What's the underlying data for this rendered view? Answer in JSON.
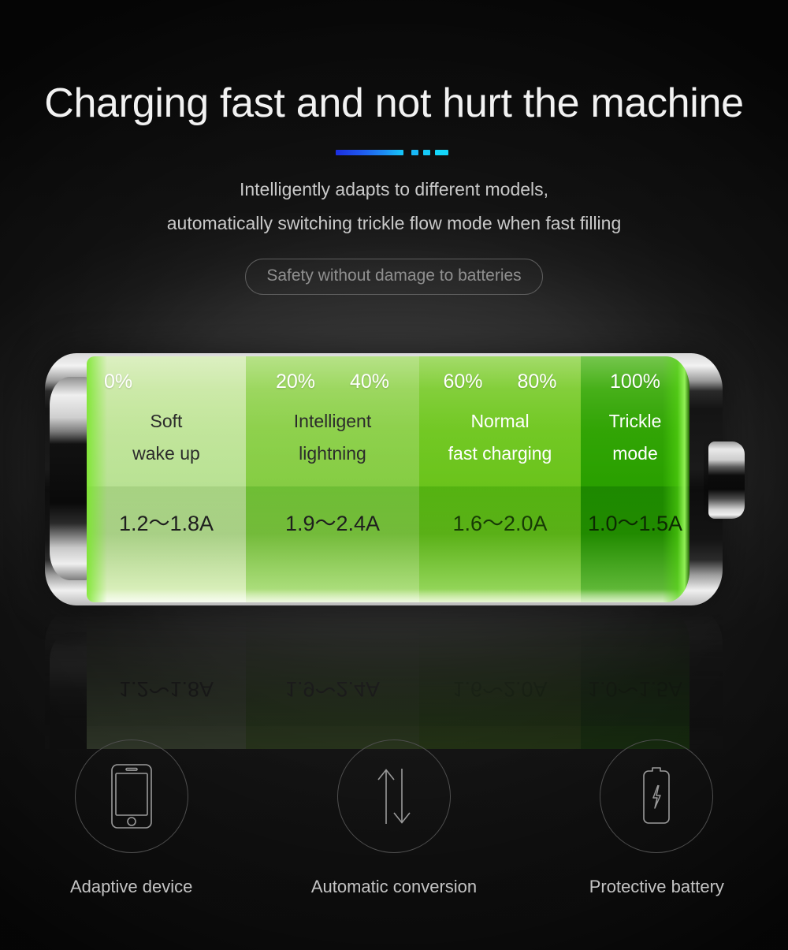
{
  "header": {
    "title": "Charging fast and not hurt the machine",
    "subtitle_line1": "Intelligently adapts to different models,",
    "subtitle_line2": "automatically switching trickle flow mode when fast filling",
    "pill_label": "Safety without damage to batteries"
  },
  "colors": {
    "background": "#171717",
    "title_text": "#f2f2f2",
    "subtitle_text": "#c9c9c9",
    "pill_border": "#5d5d5d",
    "divider_start": "#1b2ee0",
    "divider_end": "#14d6fa",
    "segment_1": "#c3e69b",
    "segment_2": "#8ed14b",
    "segment_3": "#72c822",
    "segment_4": "#2fa400"
  },
  "battery": {
    "segments": [
      {
        "percent_labels": [
          "0%"
        ],
        "mode_line1": "Soft",
        "mode_line2": "wake up",
        "current": "1.2～1.8A"
      },
      {
        "percent_labels": [
          "20%",
          "40%"
        ],
        "mode_line1": "Intelligent",
        "mode_line2": "lightning",
        "current": "1.9～2.4A"
      },
      {
        "percent_labels": [
          "60%",
          "80%"
        ],
        "mode_line1": "Normal",
        "mode_line2": "fast charging",
        "current": "1.6～2.0A"
      },
      {
        "percent_labels": [
          "100%"
        ],
        "mode_line1": "Trickle",
        "mode_line2": "mode",
        "current": "1.0～1.5A"
      }
    ]
  },
  "features": [
    {
      "icon": "smartphone-icon",
      "label": "Adaptive device"
    },
    {
      "icon": "up-down-arrows-icon",
      "label": "Automatic conversion"
    },
    {
      "icon": "battery-bolt-icon",
      "label": "Protective battery"
    }
  ]
}
